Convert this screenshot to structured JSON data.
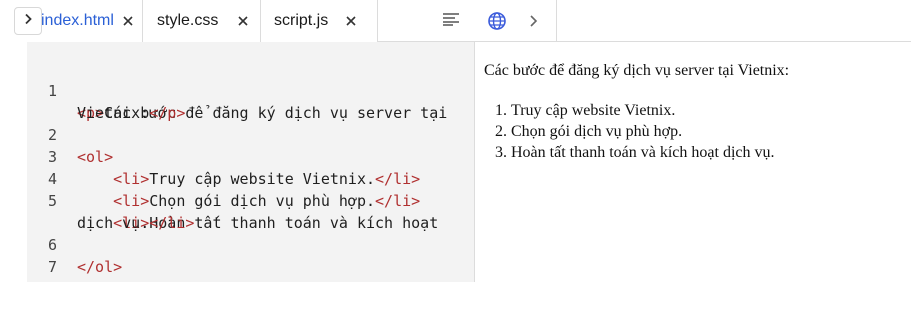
{
  "tabs": [
    {
      "label": "index.html",
      "active": true
    },
    {
      "label": "style.css",
      "active": false
    },
    {
      "label": "script.js",
      "active": false
    }
  ],
  "icons": {
    "collapse": "chevron-right-icon",
    "close": "close-icon",
    "format": "format-align-icon",
    "globe": "globe-icon",
    "next": "chevron-right-icon"
  },
  "colors": {
    "accent": "#2b60d6",
    "tag": "#b03030",
    "editor_bg": "#f3f3f3"
  },
  "code": {
    "line_numbers": [
      "1",
      "2",
      "3",
      "4",
      "5",
      "6",
      "7"
    ],
    "l1_open": "<p>",
    "l1_text": "Các bước để đăng ký dịch vụ server tại",
    "l1_wrap_text": "Vietnix:",
    "l1_close": "</p>",
    "l2": "<ol>",
    "l3_open": "<li>",
    "l3_text": "Truy cập website Vietnix.",
    "l3_close": "</li>",
    "l4_open": "<li>",
    "l4_text": "Chọn gói dịch vụ phù hợp.",
    "l4_close": "</li>",
    "l5_open": "<li>",
    "l5_text": "Hoàn tất thanh toán và kích hoạt",
    "l5_wrap_text": "dịch vụ.",
    "l5_close": "</li>",
    "l6": "</ol>"
  },
  "preview": {
    "paragraph": "Các bước để đăng ký dịch vụ server tại Vietnix:",
    "items": [
      "Truy cập website Vietnix.",
      "Chọn gói dịch vụ phù hợp.",
      "Hoàn tất thanh toán và kích hoạt dịch vụ."
    ]
  }
}
